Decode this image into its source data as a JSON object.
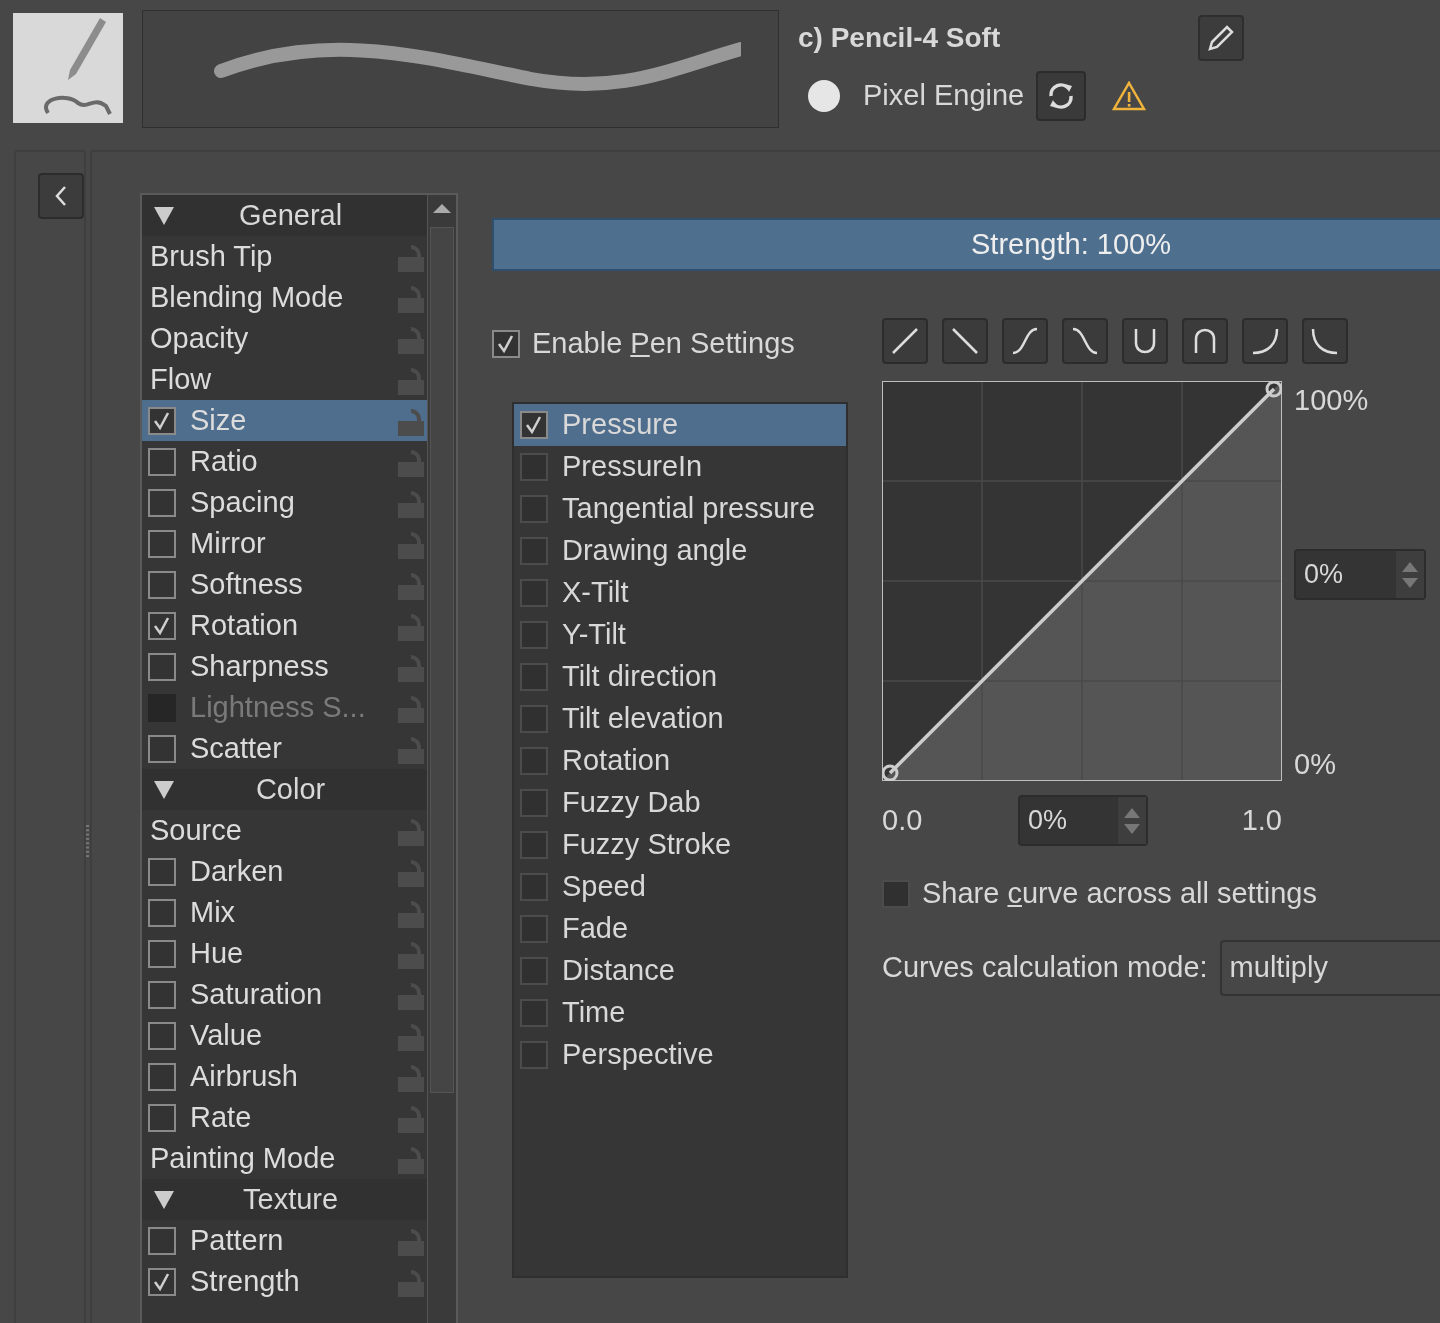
{
  "preset": {
    "title": "c) Pencil-4 Soft",
    "engine": "Pixel Engine"
  },
  "options_list": {
    "items": [
      {
        "kind": "header",
        "label": "General",
        "expanded": true,
        "selected": false
      },
      {
        "kind": "plain",
        "label": "Brush Tip",
        "selected": false
      },
      {
        "kind": "plain",
        "label": "Blending Mode",
        "selected": false
      },
      {
        "kind": "plain",
        "label": "Opacity",
        "selected": false
      },
      {
        "kind": "plain",
        "label": "Flow",
        "selected": false
      },
      {
        "kind": "check",
        "label": "Size",
        "checked": true,
        "disabled": false,
        "selected": true
      },
      {
        "kind": "check",
        "label": "Ratio",
        "checked": false,
        "disabled": false,
        "selected": false
      },
      {
        "kind": "check",
        "label": "Spacing",
        "checked": false,
        "disabled": false,
        "selected": false
      },
      {
        "kind": "check",
        "label": "Mirror",
        "checked": false,
        "disabled": false,
        "selected": false
      },
      {
        "kind": "check",
        "label": "Softness",
        "checked": false,
        "disabled": false,
        "selected": false
      },
      {
        "kind": "check",
        "label": "Rotation",
        "checked": true,
        "disabled": false,
        "selected": false
      },
      {
        "kind": "check",
        "label": "Sharpness",
        "checked": false,
        "disabled": false,
        "selected": false
      },
      {
        "kind": "check",
        "label": "Lightness S...",
        "checked": false,
        "disabled": true,
        "selected": false
      },
      {
        "kind": "check",
        "label": "Scatter",
        "checked": false,
        "disabled": false,
        "selected": false
      },
      {
        "kind": "header",
        "label": "Color",
        "expanded": true,
        "selected": false
      },
      {
        "kind": "plain",
        "label": "Source",
        "selected": false
      },
      {
        "kind": "check",
        "label": "Darken",
        "checked": false,
        "disabled": false,
        "selected": false
      },
      {
        "kind": "check",
        "label": "Mix",
        "checked": false,
        "disabled": false,
        "selected": false
      },
      {
        "kind": "check",
        "label": "Hue",
        "checked": false,
        "disabled": false,
        "selected": false
      },
      {
        "kind": "check",
        "label": "Saturation",
        "checked": false,
        "disabled": false,
        "selected": false
      },
      {
        "kind": "check",
        "label": "Value",
        "checked": false,
        "disabled": false,
        "selected": false
      },
      {
        "kind": "check",
        "label": "Airbrush",
        "checked": false,
        "disabled": false,
        "selected": false
      },
      {
        "kind": "check",
        "label": "Rate",
        "checked": false,
        "disabled": false,
        "selected": false
      },
      {
        "kind": "plain",
        "label": "Painting Mode",
        "selected": false
      },
      {
        "kind": "header",
        "label": "Texture",
        "expanded": true,
        "selected": false
      },
      {
        "kind": "check",
        "label": "Pattern",
        "checked": false,
        "disabled": false,
        "selected": false
      },
      {
        "kind": "check",
        "label": "Strength",
        "checked": true,
        "disabled": false,
        "selected": false
      }
    ]
  },
  "strength": {
    "label": "Strength: 100%",
    "level": 1
  },
  "enable_pen_settings": {
    "checked": true,
    "label_parts": [
      "Enable ",
      "P",
      "en Settings"
    ]
  },
  "sensors": [
    {
      "label": "Pressure",
      "checked": true,
      "selected": true
    },
    {
      "label": "PressureIn",
      "checked": false,
      "selected": false
    },
    {
      "label": "Tangential pressure",
      "checked": false,
      "selected": false
    },
    {
      "label": "Drawing angle",
      "checked": false,
      "selected": false
    },
    {
      "label": "X-Tilt",
      "checked": false,
      "selected": false
    },
    {
      "label": "Y-Tilt",
      "checked": false,
      "selected": false
    },
    {
      "label": "Tilt direction",
      "checked": false,
      "selected": false
    },
    {
      "label": "Tilt elevation",
      "checked": false,
      "selected": false
    },
    {
      "label": "Rotation",
      "checked": false,
      "selected": false
    },
    {
      "label": "Fuzzy Dab",
      "checked": false,
      "selected": false
    },
    {
      "label": "Fuzzy Stroke",
      "checked": false,
      "selected": false
    },
    {
      "label": "Speed",
      "checked": false,
      "selected": false
    },
    {
      "label": "Fade",
      "checked": false,
      "selected": false
    },
    {
      "label": "Distance",
      "checked": false,
      "selected": false
    },
    {
      "label": "Time",
      "checked": false,
      "selected": false
    },
    {
      "label": "Perspective",
      "checked": false,
      "selected": false
    }
  ],
  "curve_presets": [
    {
      "kind": "linear"
    },
    {
      "kind": "reverse-linear"
    },
    {
      "kind": "s-curve"
    },
    {
      "kind": "reverse-s-curve"
    },
    {
      "kind": "u-curve"
    },
    {
      "kind": "n-curve"
    },
    {
      "kind": "j-curve"
    },
    {
      "kind": "reverse-j-curve"
    }
  ],
  "curve": {
    "y_max_label": "100%",
    "y_value": "0%",
    "y_min_label": "0%",
    "x_min_label": "0.0",
    "x_value": "0%",
    "x_max_label": "1.0"
  },
  "share_curve": {
    "checked": false,
    "label_parts": [
      "Share ",
      "c",
      "urve across all settings"
    ]
  },
  "calculation_mode": {
    "label": "Curves calculation mode:",
    "value": "multiply"
  }
}
